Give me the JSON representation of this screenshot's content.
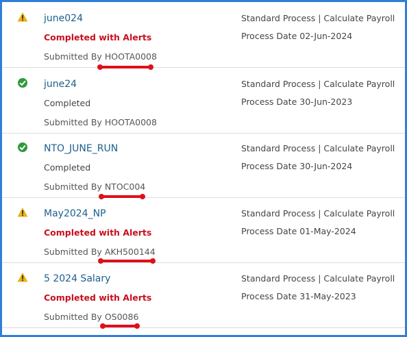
{
  "colors": {
    "frame_border": "#2f7fd6",
    "title": "#1b5f8c",
    "alert_status": "#c8101e",
    "warning_icon": "#e8b21a",
    "success_icon": "#2f9a3a",
    "annotation": "#e0101a"
  },
  "submitted_label": "Submitted By",
  "process_date_label": "Process Date",
  "runs": [
    {
      "icon": "warning-icon",
      "title": "june024",
      "status": "Completed with Alerts",
      "submitted_by": "HOOTA0008",
      "process": "Standard Process | Calculate Payroll",
      "process_date": "02-Jun-2024",
      "underlined": true
    },
    {
      "icon": "success-check-icon",
      "title": "june24",
      "status": "Completed",
      "submitted_by": "HOOTA0008",
      "process": "Standard Process | Calculate Payroll",
      "process_date": "30-Jun-2023",
      "underlined": false
    },
    {
      "icon": "success-check-icon",
      "title": "NTO_JUNE_RUN",
      "status": "Completed",
      "submitted_by": "NTOC004",
      "process": "Standard Process | Calculate Payroll",
      "process_date": "30-Jun-2024",
      "underlined": true
    },
    {
      "icon": "warning-icon",
      "title": "May2024_NP",
      "status": "Completed with Alerts",
      "submitted_by": "AKH500144",
      "process": "Standard Process | Calculate Payroll",
      "process_date": "01-May-2024",
      "underlined": true
    },
    {
      "icon": "warning-icon",
      "title": "5 2024 Salary",
      "status": "Completed with Alerts",
      "submitted_by": "OS0086",
      "process": "Standard Process | Calculate Payroll",
      "process_date": "31-May-2023",
      "underlined": true
    }
  ]
}
